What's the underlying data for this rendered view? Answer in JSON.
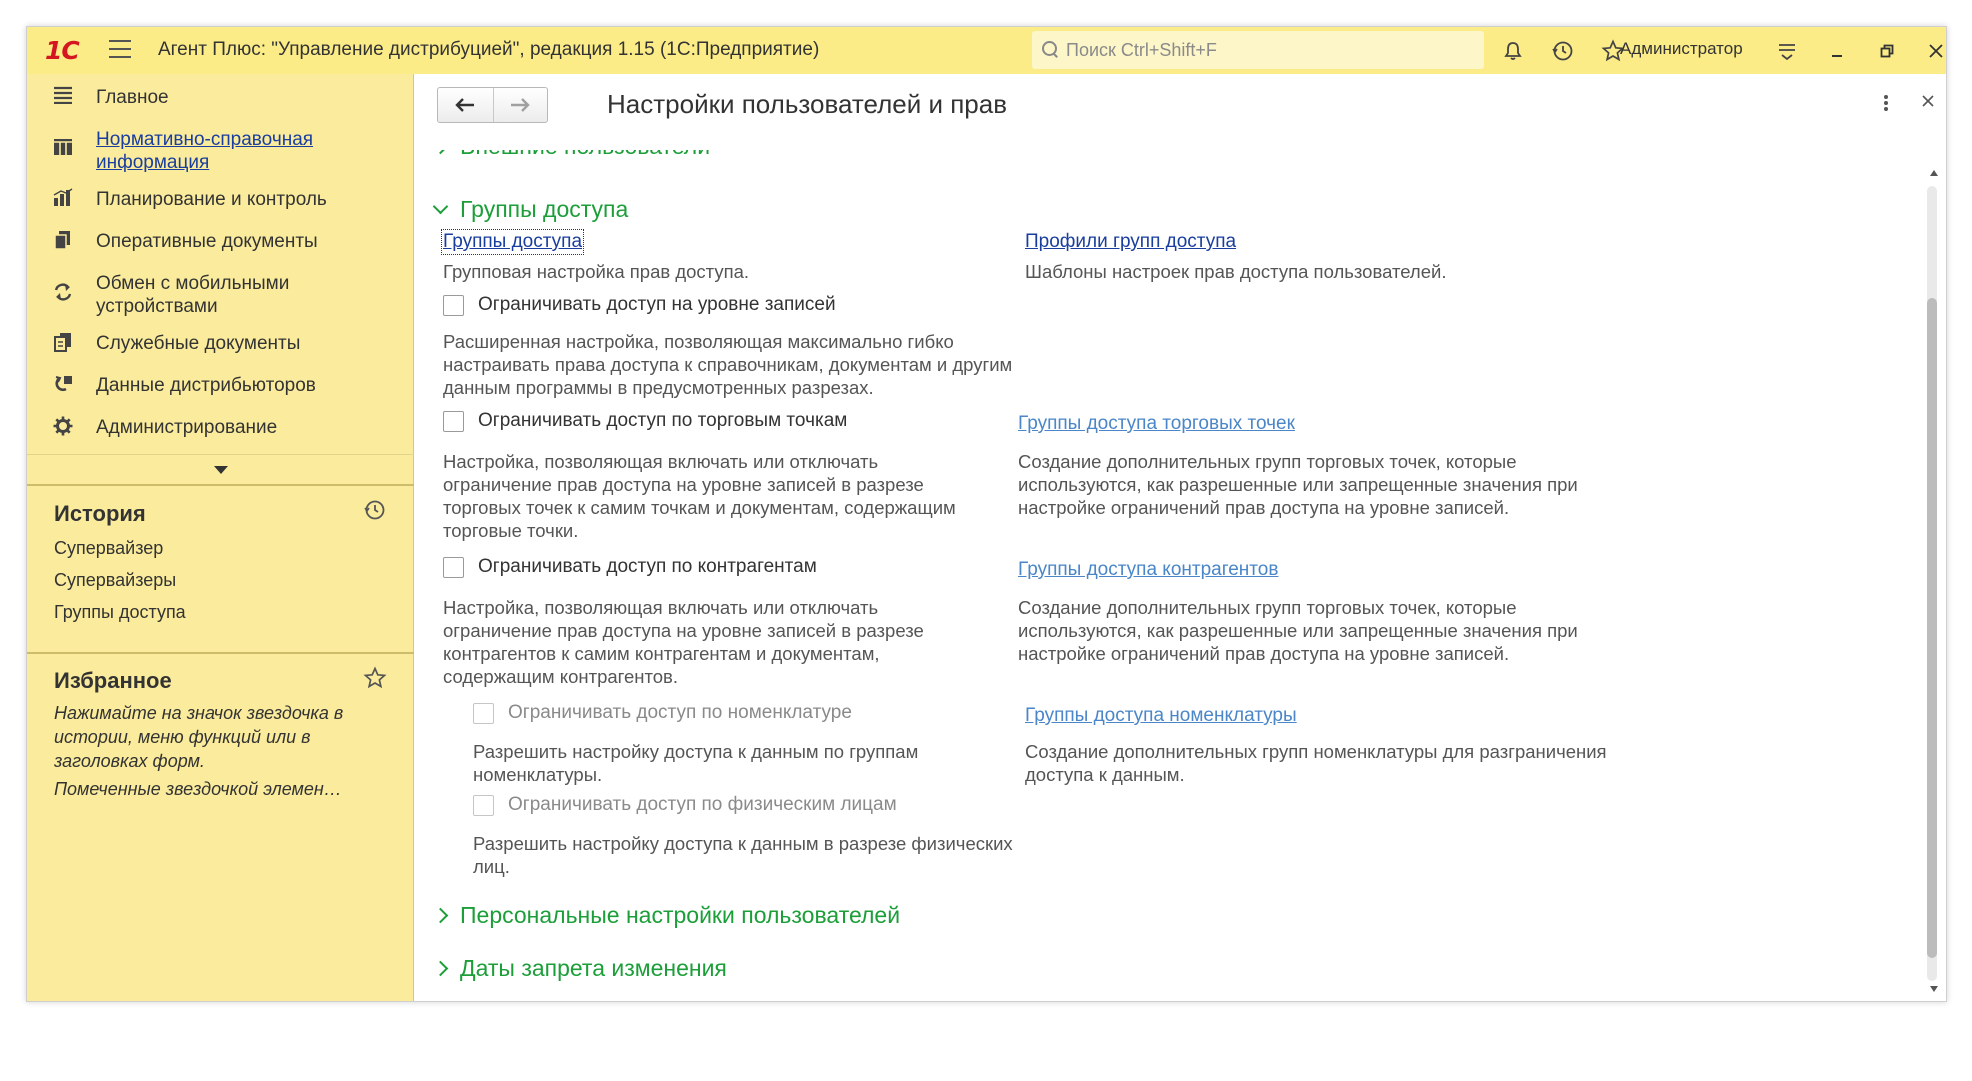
{
  "titlebar": {
    "logo": "1С",
    "app_title": "Агент Плюс: \"Управление дистрибуцией\", редакция 1.15  (1С:Предприятие)",
    "search_placeholder": "Поиск Ctrl+Shift+F",
    "user": "Администратор"
  },
  "sidebar": {
    "nav": [
      {
        "label": "Главное",
        "icon": "menu-lines-icon"
      },
      {
        "label": "Нормативно-справочная информация",
        "icon": "grid-icon"
      },
      {
        "label": "Планирование и контроль",
        "icon": "bar-chart-icon"
      },
      {
        "label": "Оперативные документы",
        "icon": "documents-icon"
      },
      {
        "label": "Обмен с мобильными устройствами",
        "icon": "sync-icon"
      },
      {
        "label": "Служебные документы",
        "icon": "service-docs-icon"
      },
      {
        "label": "Данные дистрибьюторов",
        "icon": "distributor-icon"
      },
      {
        "label": "Администрирование",
        "icon": "gear-icon"
      }
    ],
    "nav_label_lines": {
      "nsi_1": "Нормативно-справочная",
      "nsi_2": "информация",
      "mobile_1": "Обмен с мобильными",
      "mobile_2": "устройствами"
    },
    "history": {
      "title": "История",
      "items": [
        "Супервайзер",
        "Супервайзеры",
        "Группы доступа"
      ]
    },
    "favorites": {
      "title": "Избранное",
      "hint": "Нажимайте на значок звездочка в истории, меню функций или в заголовках форм.",
      "marked": "Помеченные звездочкой элемен…"
    }
  },
  "main": {
    "form_title": "Настройки пользователей и прав",
    "cut_section": "Внешние пользователи",
    "access_groups": {
      "title": "Группы доступа",
      "groups_link": "Группы доступа",
      "groups_desc": "Групповая настройка прав доступа.",
      "profiles_link": "Профили групп доступа",
      "profiles_desc": "Шаблоны настроек прав доступа пользователей.",
      "restrict_records_label": "Ограничивать доступ на уровне записей",
      "restrict_records_desc_1": "Расширенная настройка, позволяющая максимально гибко",
      "restrict_records_desc_2": "настраивать права доступа к справочникам, документам и другим",
      "restrict_records_desc_3": "данным программы в предусмотренных разрезах.",
      "restrict_outlets_label": "Ограничивать доступ по торговым точкам",
      "restrict_outlets_desc_1": "Настройка, позволяющая включать или отключать",
      "restrict_outlets_desc_2": "ограничение прав доступа на уровне записей в разрезе",
      "restrict_outlets_desc_3": "торговых точек к самим точкам и документам, содержащим",
      "restrict_outlets_desc_4": "торговые точки.",
      "outlet_groups_link": "Группы доступа торговых точек",
      "outlet_groups_desc_1": "Создание дополнительных групп торговых точек, которые",
      "outlet_groups_desc_2": "используются, как разрешенные или запрещенные значения при",
      "outlet_groups_desc_3": "настройке ограничений прав доступа на уровне записей.",
      "restrict_contractors_label": "Ограничивать доступ по контрагентам",
      "restrict_contractors_desc_1": "Настройка, позволяющая включать или отключать",
      "restrict_contractors_desc_2": "ограничение прав доступа на уровне записей в разрезе",
      "restrict_contractors_desc_3": "контрагентов к самим контрагентам и документам,",
      "restrict_contractors_desc_4": "содержащим контрагентов.",
      "contractor_groups_link": "Группы доступа контрагентов",
      "contractor_groups_desc_1": "Создание дополнительных групп торговых точек, которые",
      "contractor_groups_desc_2": "используются, как разрешенные или запрещенные значения при",
      "contractor_groups_desc_3": "настройке ограничений прав доступа на уровне записей.",
      "restrict_nomenclature_label": "Ограничивать доступ по номенклатуре",
      "restrict_nomenclature_desc_1": "Разрешить настройку доступа к данным по группам",
      "restrict_nomenclature_desc_2": "номенклатуры.",
      "nomenclature_groups_link": "Группы доступа номенклатуры",
      "nomenclature_groups_desc_1": "Создание дополнительных групп номенклатуры для разграничения",
      "nomenclature_groups_desc_2": "доступа к данным.",
      "restrict_persons_label": "Ограничивать доступ по физическим лицам",
      "restrict_persons_desc_1": "Разрешить настройку доступа к данным в разрезе физических",
      "restrict_persons_desc_2": "лиц."
    },
    "personal_settings": "Персональные настройки пользователей",
    "change_prohibition_dates": "Даты запрета изменения"
  },
  "colors": {
    "titlebar_bg": "#fbec88",
    "sidebar_bg": "#fbec9d",
    "group_header": "#1c9e39",
    "link": "#1a3e9e",
    "logo": "#d3161f"
  }
}
